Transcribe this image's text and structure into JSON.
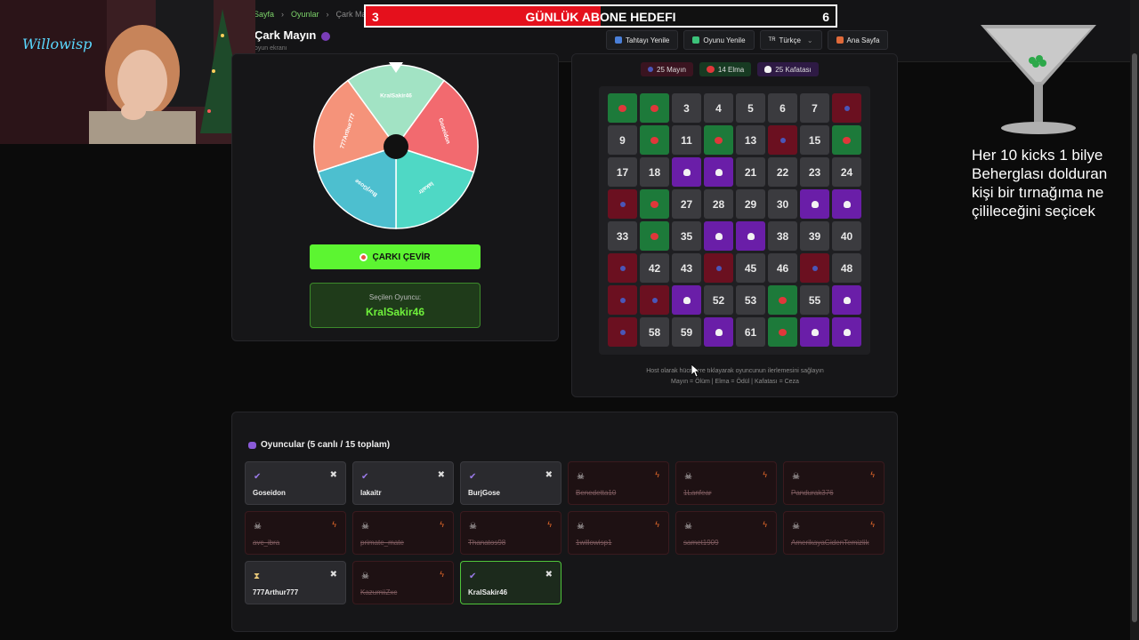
{
  "breadcrumb": [
    "Sayfa",
    "Oyunlar",
    "Çark Mayın"
  ],
  "page": {
    "title": "Çark Mayın",
    "subtitle": "oyun ekranı"
  },
  "toolbar": {
    "refresh_board": "Tahtayı Yenile",
    "new_game": "Oyunu Yenile",
    "lang_flag": "TR",
    "language": "Türkçe",
    "home": "Ana Sayfa"
  },
  "sub_goal": {
    "label": "GÜNLÜK ABONE HEDEFI",
    "current": "3",
    "target": "6",
    "progress": 0.5
  },
  "wheel": {
    "segments": [
      "KralSakir46",
      "Goseidon",
      "lakaitr",
      "BurjGose",
      "777Arthur777"
    ],
    "colors": [
      "#a2e3c4",
      "#f26a6f",
      "#4fd8c5",
      "#4dbfcf",
      "#f5937a"
    ]
  },
  "spin_button": "ÇARKI ÇEVİR",
  "selected": {
    "label": "Seçilen Oyuncu:",
    "name": "KralSakir46"
  },
  "counters": {
    "mines": "25 Mayın",
    "apples": "14 Elma",
    "skulls": "25 Kafatası"
  },
  "board": {
    "cells": [
      "A",
      "A",
      "3",
      "4",
      "5",
      "6",
      "7",
      "M",
      "9",
      "A",
      "11",
      "A",
      "13",
      "M",
      "15",
      "A",
      "17",
      "18",
      "S",
      "S",
      "21",
      "22",
      "23",
      "24",
      "M",
      "A",
      "27",
      "28",
      "29",
      "30",
      "S",
      "S",
      "33",
      "A",
      "35",
      "S",
      "S",
      "38",
      "39",
      "40",
      "M",
      "42",
      "43",
      "M",
      "45",
      "46",
      "M",
      "48",
      "M",
      "M",
      "S",
      "52",
      "53",
      "A",
      "55",
      "S",
      "M",
      "58",
      "59",
      "S",
      "61",
      "A",
      "S",
      "S"
    ]
  },
  "hint": {
    "line1": "Host olarak hücrelere tıklayarak oyuncunun ilerlemesini sağlayın",
    "line2": "Mayın = Ölüm | Elma = Ödül | Kafatası = Ceza"
  },
  "players": {
    "title": "Oyuncular (5 canlı / 15 toplam)",
    "list": [
      {
        "name": "Goseidon",
        "status": "alive"
      },
      {
        "name": "lakaitr",
        "status": "alive"
      },
      {
        "name": "BurjGose",
        "status": "alive"
      },
      {
        "name": "Benedetta10",
        "status": "dead"
      },
      {
        "name": "1Lanfear",
        "status": "dead"
      },
      {
        "name": "Pandurak376",
        "status": "dead"
      },
      {
        "name": "avc_ibra",
        "status": "dead"
      },
      {
        "name": "primate_mate",
        "status": "dead"
      },
      {
        "name": "Thanatos98",
        "status": "dead"
      },
      {
        "name": "1willowisp1",
        "status": "dead"
      },
      {
        "name": "samet1909",
        "status": "dead"
      },
      {
        "name": "AmerikayaGidenTemizlik",
        "status": "dead"
      },
      {
        "name": "777Arthur777",
        "status": "waiting"
      },
      {
        "name": "KazumiiZxc",
        "status": "dead"
      },
      {
        "name": "KralSakir46",
        "status": "selected"
      }
    ]
  },
  "overlay": {
    "text": "Her 10 kicks 1 bilye Beherglası dolduran kişi bir tırnağıma ne çilileceğini seçicek"
  },
  "colors": {
    "accent": "#5cf531",
    "mine": "#6b1020",
    "apple": "#1d7a3a",
    "skull": "#6a1ea8",
    "goal_bar": "#e5101c"
  }
}
